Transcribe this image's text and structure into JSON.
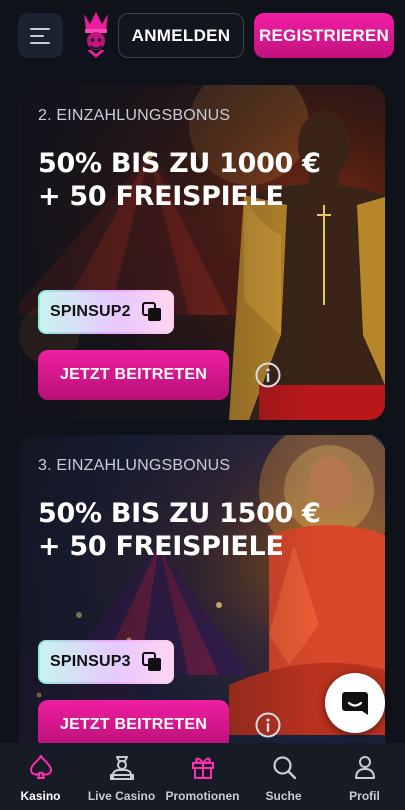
{
  "header": {
    "menu_icon": "hamburger-menu-icon",
    "logo_icon": "jester-hat-logo-icon",
    "login_label": "ANMELDEN",
    "register_label": "REGISTRIEREN"
  },
  "promos": [
    {
      "eyebrow": "2. EINZAHLUNGSBONUS",
      "title": "50% BIS ZU 1000 € + 50 FREISPIELE",
      "code": "SPINSUP2",
      "cta": "JETZT BEITRETEN"
    },
    {
      "eyebrow": "3. EINZAHLUNGSBONUS",
      "title": "50% BIS ZU 1500 € + 50 FREISPIELE",
      "code": "SPINSUP3",
      "cta": "JETZT BEITRETEN"
    }
  ],
  "chat": {
    "icon": "chat-bubble-icon"
  },
  "bottom_nav": {
    "items": [
      {
        "label": "Kasino",
        "icon": "spade-icon",
        "active": true
      },
      {
        "label": "Live Casino",
        "icon": "dealer-icon",
        "active": false
      },
      {
        "label": "Promotionen",
        "icon": "gift-icon",
        "active": false
      },
      {
        "label": "Suche",
        "icon": "search-icon",
        "active": false
      },
      {
        "label": "Profil",
        "icon": "user-icon",
        "active": false
      }
    ]
  },
  "colors": {
    "accent": "#e91e9c",
    "background": "#0f1219",
    "nav_background": "#171b25"
  }
}
